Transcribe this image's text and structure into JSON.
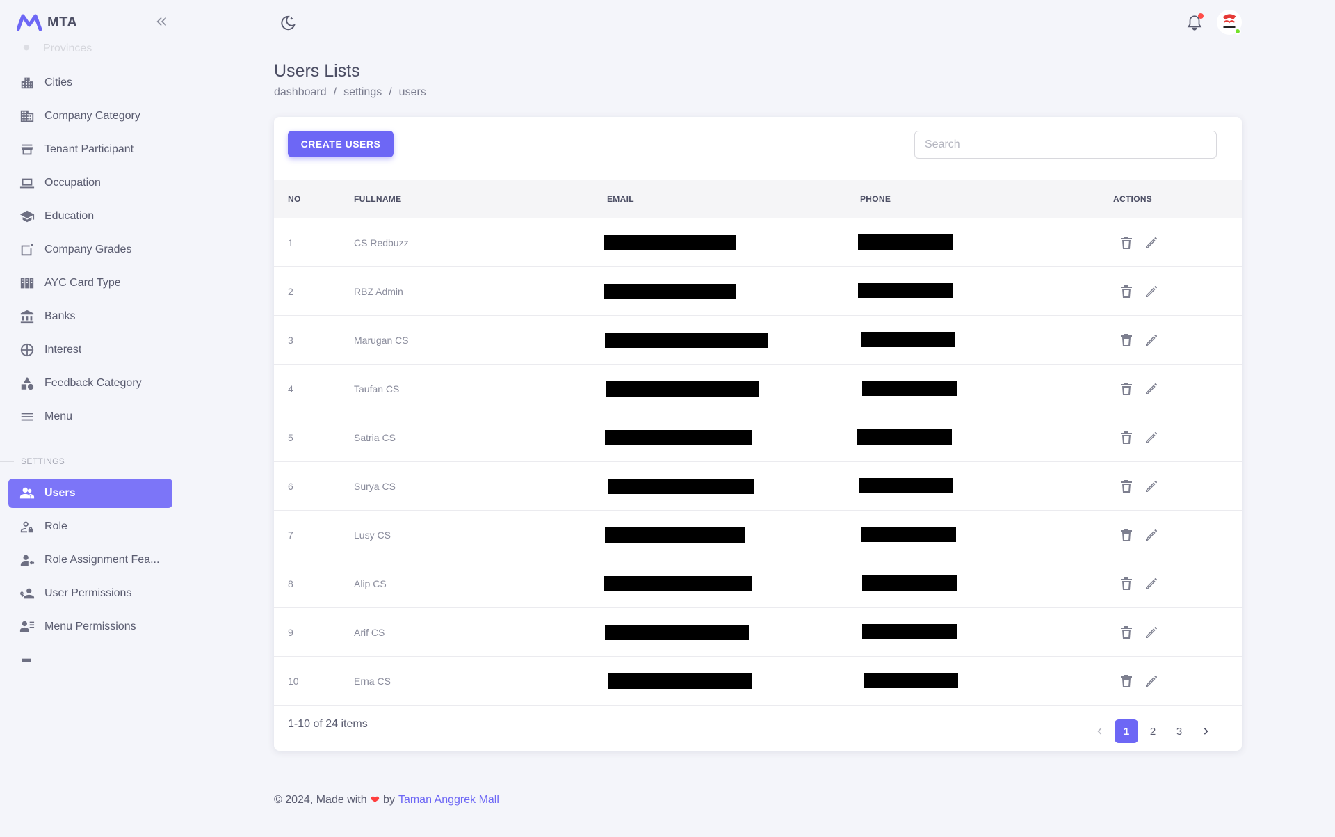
{
  "app": {
    "name": "MTA"
  },
  "sidebar": {
    "faded_item": "Provinces",
    "items": [
      {
        "label": "Cities",
        "icon": "city-icon"
      },
      {
        "label": "Company Category",
        "icon": "building-icon"
      },
      {
        "label": "Tenant Participant",
        "icon": "store-icon"
      },
      {
        "label": "Occupation",
        "icon": "laptop-icon"
      },
      {
        "label": "Education",
        "icon": "graduation-cap-icon"
      },
      {
        "label": "Company Grades",
        "icon": "grade-icon"
      },
      {
        "label": "AYC Card Type",
        "icon": "card-type-icon"
      },
      {
        "label": "Banks",
        "icon": "bank-icon"
      },
      {
        "label": "Interest",
        "icon": "interest-icon"
      },
      {
        "label": "Feedback Category",
        "icon": "shapes-icon"
      },
      {
        "label": "Menu",
        "icon": "menu-icon"
      }
    ],
    "section_settings": "SETTINGS",
    "settings_items": [
      {
        "label": "Users",
        "icon": "users-icon",
        "active": true
      },
      {
        "label": "Role",
        "icon": "user-lock-icon"
      },
      {
        "label": "Role Assignment Fea...",
        "icon": "user-assign-icon"
      },
      {
        "label": "User Permissions",
        "icon": "user-key-icon"
      },
      {
        "label": "Menu Permissions",
        "icon": "user-list-icon"
      }
    ]
  },
  "header": {
    "title": "Users Lists",
    "breadcrumb": [
      "dashboard",
      "settings",
      "users"
    ],
    "breadcrumb_sep": "/"
  },
  "toolbar": {
    "create_label": "CREATE USERS",
    "search_placeholder": "Search"
  },
  "table": {
    "columns": [
      "NO",
      "FULLNAME",
      "EMAIL",
      "PHONE",
      "ACTIONS"
    ],
    "rows": [
      {
        "no": "1",
        "fullname": "CS Redbuzz"
      },
      {
        "no": "2",
        "fullname": "RBZ Admin"
      },
      {
        "no": "3",
        "fullname": "Marugan CS"
      },
      {
        "no": "4",
        "fullname": "Taufan CS"
      },
      {
        "no": "5",
        "fullname": "Satria CS"
      },
      {
        "no": "6",
        "fullname": "Surya CS"
      },
      {
        "no": "7",
        "fullname": "Lusy CS"
      },
      {
        "no": "8",
        "fullname": "Alip CS"
      },
      {
        "no": "9",
        "fullname": "Arif CS"
      },
      {
        "no": "10",
        "fullname": "Erna CS"
      }
    ]
  },
  "pagination": {
    "info": "1-10 of 24 items",
    "pages": [
      "1",
      "2",
      "3"
    ],
    "current": "1"
  },
  "footer": {
    "prefix": "© 2024, Made with",
    "by": "by",
    "link": "Taman Anggrek Mall"
  },
  "colors": {
    "primary": "#6d67f5",
    "active_nav": "#7c75f8",
    "notification_dot": "#ff4d49",
    "online": "#72e128"
  }
}
